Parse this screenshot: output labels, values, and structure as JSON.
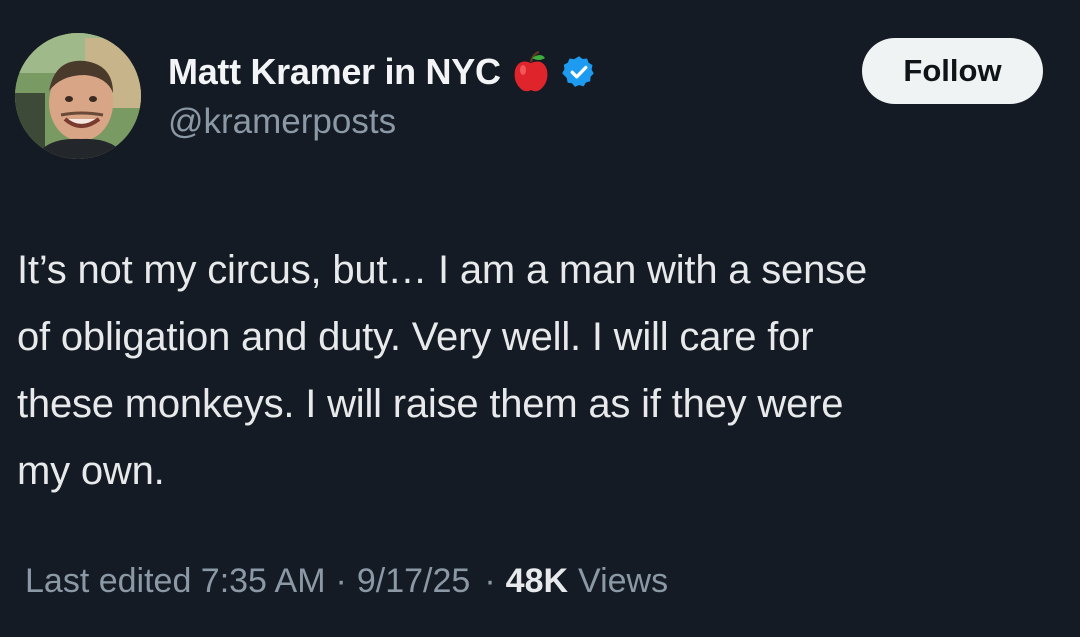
{
  "author": {
    "display_name": "Matt Kramer in NYC",
    "handle": "@kramerposts",
    "name_emoji": "apple-icon",
    "verified_badge": "verified-badge-icon"
  },
  "follow_button": {
    "label": "Follow"
  },
  "tweet": {
    "lines": [
      "It’s not my circus, but… I am a man with a sense",
      "of obligation and duty. Very well. I will care for",
      "these monkeys. I will raise them as if they were",
      "my own."
    ]
  },
  "meta": {
    "edited_label": "Last edited 7:35 AM",
    "separator": "·",
    "date": "9/17/25",
    "views_count": "48K",
    "views_label": "Views"
  },
  "colors": {
    "background": "#141b24",
    "text": "#e7e9ea",
    "secondary_text": "#8b98a5",
    "verified_blue": "#1d9bf0",
    "apple_red": "#e0242b"
  }
}
